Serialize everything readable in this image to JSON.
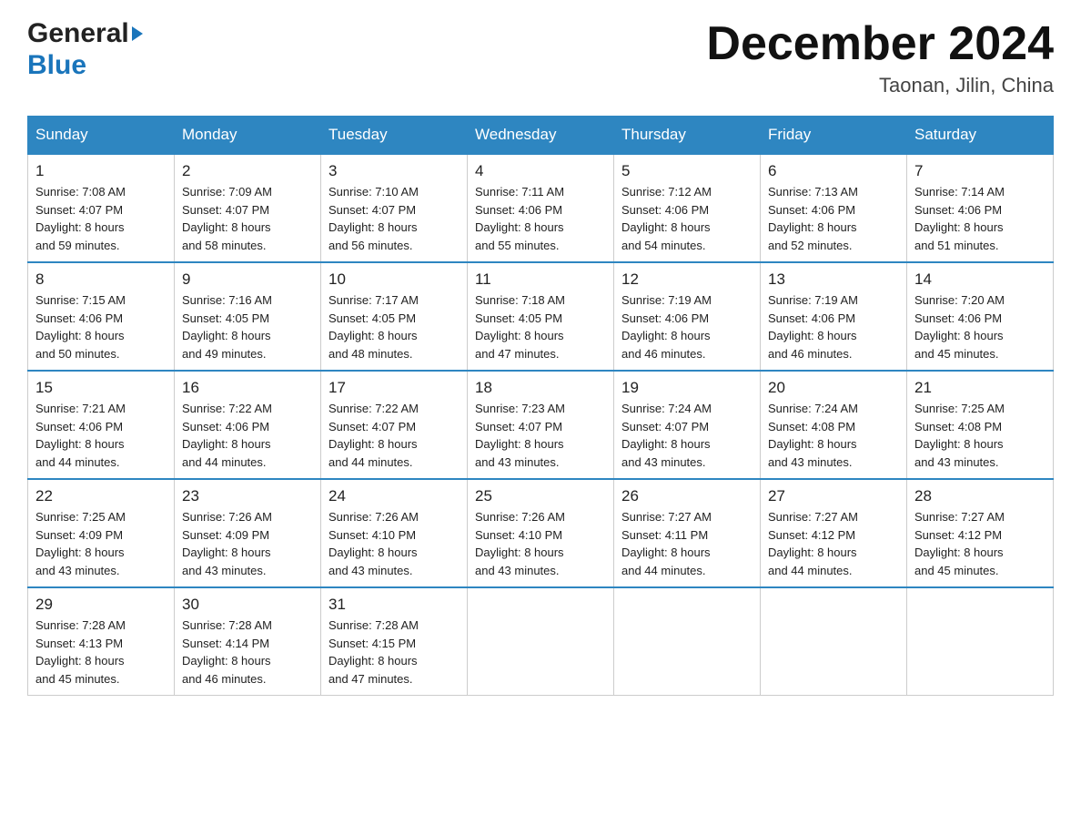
{
  "header": {
    "logo_general": "General",
    "logo_blue": "Blue",
    "month_title": "December 2024",
    "location": "Taonan, Jilin, China"
  },
  "days_of_week": [
    "Sunday",
    "Monday",
    "Tuesday",
    "Wednesday",
    "Thursday",
    "Friday",
    "Saturday"
  ],
  "weeks": [
    [
      {
        "num": "1",
        "sunrise": "7:08 AM",
        "sunset": "4:07 PM",
        "daylight": "8 hours and 59 minutes."
      },
      {
        "num": "2",
        "sunrise": "7:09 AM",
        "sunset": "4:07 PM",
        "daylight": "8 hours and 58 minutes."
      },
      {
        "num": "3",
        "sunrise": "7:10 AM",
        "sunset": "4:07 PM",
        "daylight": "8 hours and 56 minutes."
      },
      {
        "num": "4",
        "sunrise": "7:11 AM",
        "sunset": "4:06 PM",
        "daylight": "8 hours and 55 minutes."
      },
      {
        "num": "5",
        "sunrise": "7:12 AM",
        "sunset": "4:06 PM",
        "daylight": "8 hours and 54 minutes."
      },
      {
        "num": "6",
        "sunrise": "7:13 AM",
        "sunset": "4:06 PM",
        "daylight": "8 hours and 52 minutes."
      },
      {
        "num": "7",
        "sunrise": "7:14 AM",
        "sunset": "4:06 PM",
        "daylight": "8 hours and 51 minutes."
      }
    ],
    [
      {
        "num": "8",
        "sunrise": "7:15 AM",
        "sunset": "4:06 PM",
        "daylight": "8 hours and 50 minutes."
      },
      {
        "num": "9",
        "sunrise": "7:16 AM",
        "sunset": "4:05 PM",
        "daylight": "8 hours and 49 minutes."
      },
      {
        "num": "10",
        "sunrise": "7:17 AM",
        "sunset": "4:05 PM",
        "daylight": "8 hours and 48 minutes."
      },
      {
        "num": "11",
        "sunrise": "7:18 AM",
        "sunset": "4:05 PM",
        "daylight": "8 hours and 47 minutes."
      },
      {
        "num": "12",
        "sunrise": "7:19 AM",
        "sunset": "4:06 PM",
        "daylight": "8 hours and 46 minutes."
      },
      {
        "num": "13",
        "sunrise": "7:19 AM",
        "sunset": "4:06 PM",
        "daylight": "8 hours and 46 minutes."
      },
      {
        "num": "14",
        "sunrise": "7:20 AM",
        "sunset": "4:06 PM",
        "daylight": "8 hours and 45 minutes."
      }
    ],
    [
      {
        "num": "15",
        "sunrise": "7:21 AM",
        "sunset": "4:06 PM",
        "daylight": "8 hours and 44 minutes."
      },
      {
        "num": "16",
        "sunrise": "7:22 AM",
        "sunset": "4:06 PM",
        "daylight": "8 hours and 44 minutes."
      },
      {
        "num": "17",
        "sunrise": "7:22 AM",
        "sunset": "4:07 PM",
        "daylight": "8 hours and 44 minutes."
      },
      {
        "num": "18",
        "sunrise": "7:23 AM",
        "sunset": "4:07 PM",
        "daylight": "8 hours and 43 minutes."
      },
      {
        "num": "19",
        "sunrise": "7:24 AM",
        "sunset": "4:07 PM",
        "daylight": "8 hours and 43 minutes."
      },
      {
        "num": "20",
        "sunrise": "7:24 AM",
        "sunset": "4:08 PM",
        "daylight": "8 hours and 43 minutes."
      },
      {
        "num": "21",
        "sunrise": "7:25 AM",
        "sunset": "4:08 PM",
        "daylight": "8 hours and 43 minutes."
      }
    ],
    [
      {
        "num": "22",
        "sunrise": "7:25 AM",
        "sunset": "4:09 PM",
        "daylight": "8 hours and 43 minutes."
      },
      {
        "num": "23",
        "sunrise": "7:26 AM",
        "sunset": "4:09 PM",
        "daylight": "8 hours and 43 minutes."
      },
      {
        "num": "24",
        "sunrise": "7:26 AM",
        "sunset": "4:10 PM",
        "daylight": "8 hours and 43 minutes."
      },
      {
        "num": "25",
        "sunrise": "7:26 AM",
        "sunset": "4:10 PM",
        "daylight": "8 hours and 43 minutes."
      },
      {
        "num": "26",
        "sunrise": "7:27 AM",
        "sunset": "4:11 PM",
        "daylight": "8 hours and 44 minutes."
      },
      {
        "num": "27",
        "sunrise": "7:27 AM",
        "sunset": "4:12 PM",
        "daylight": "8 hours and 44 minutes."
      },
      {
        "num": "28",
        "sunrise": "7:27 AM",
        "sunset": "4:12 PM",
        "daylight": "8 hours and 45 minutes."
      }
    ],
    [
      {
        "num": "29",
        "sunrise": "7:28 AM",
        "sunset": "4:13 PM",
        "daylight": "8 hours and 45 minutes."
      },
      {
        "num": "30",
        "sunrise": "7:28 AM",
        "sunset": "4:14 PM",
        "daylight": "8 hours and 46 minutes."
      },
      {
        "num": "31",
        "sunrise": "7:28 AM",
        "sunset": "4:15 PM",
        "daylight": "8 hours and 47 minutes."
      },
      null,
      null,
      null,
      null
    ]
  ],
  "labels": {
    "sunrise": "Sunrise:",
    "sunset": "Sunset:",
    "daylight": "Daylight:"
  }
}
